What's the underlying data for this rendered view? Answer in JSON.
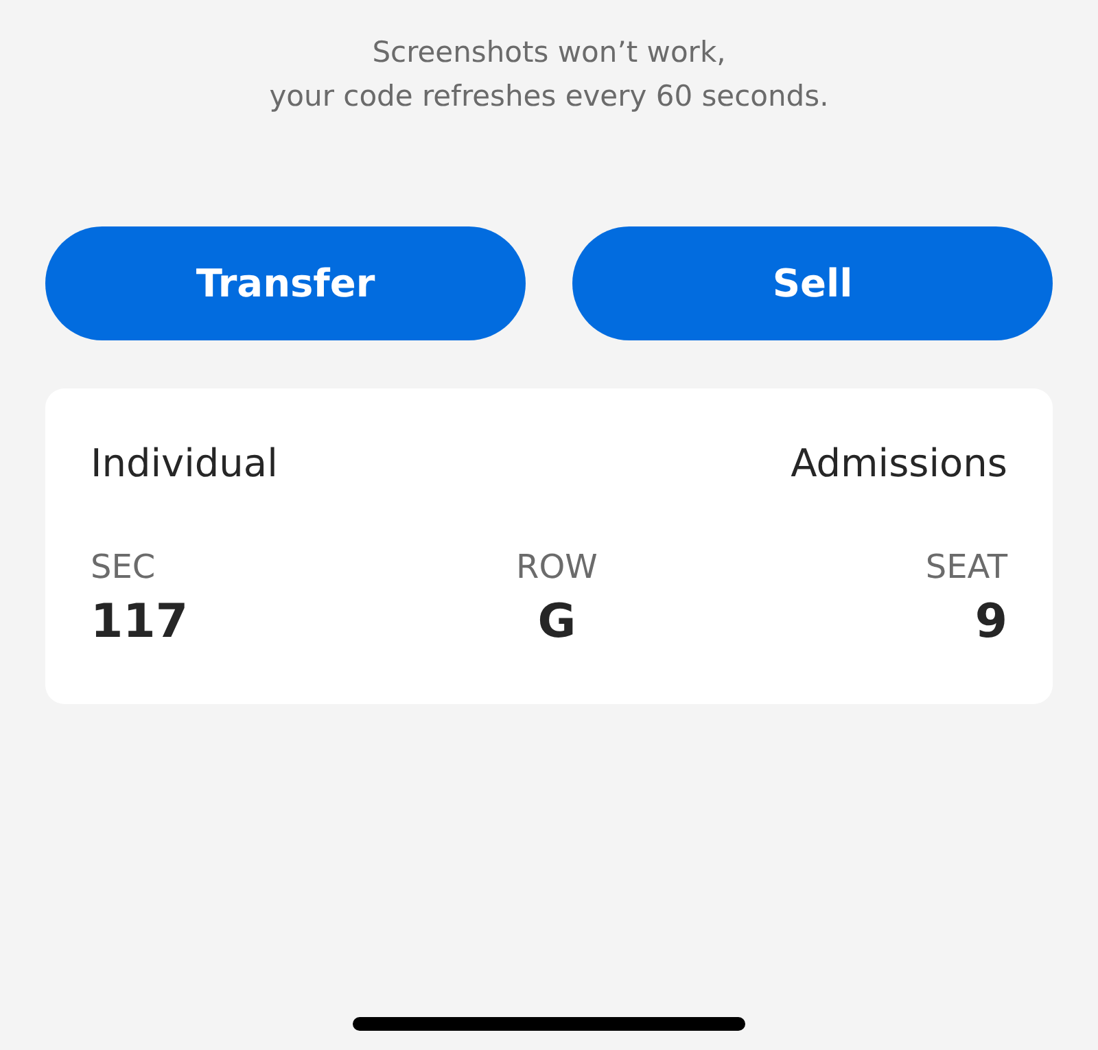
{
  "message": {
    "lines": [
      "Screenshots won’t work,",
      "your code refreshes every 60 seconds."
    ]
  },
  "buttons": [
    {
      "label": "Transfer"
    },
    {
      "label": "Sell"
    }
  ],
  "ticket": {
    "title_left": "Individual",
    "title_right": "Admissions",
    "fields": [
      {
        "label": "SEC",
        "value": "117"
      },
      {
        "label": "ROW",
        "value": "G"
      },
      {
        "label": "SEAT",
        "value": "9"
      }
    ]
  }
}
